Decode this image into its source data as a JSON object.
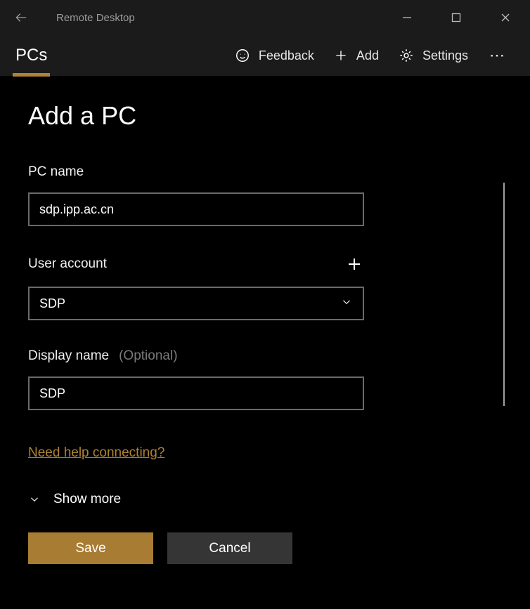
{
  "window": {
    "title": "Remote Desktop"
  },
  "nav": {
    "tab": "PCs"
  },
  "toolbar": {
    "feedback": "Feedback",
    "add": "Add",
    "settings": "Settings"
  },
  "page": {
    "heading": "Add a PC",
    "pc_name_label": "PC name",
    "pc_name_value": "sdp.ipp.ac.cn",
    "user_account_label": "User account",
    "user_account_value": "SDP",
    "display_name_label": "Display name",
    "optional_hint": "(Optional)",
    "display_name_value": "SDP",
    "help_link": "Need help connecting?",
    "show_more": "Show more",
    "save": "Save",
    "cancel": "Cancel"
  }
}
